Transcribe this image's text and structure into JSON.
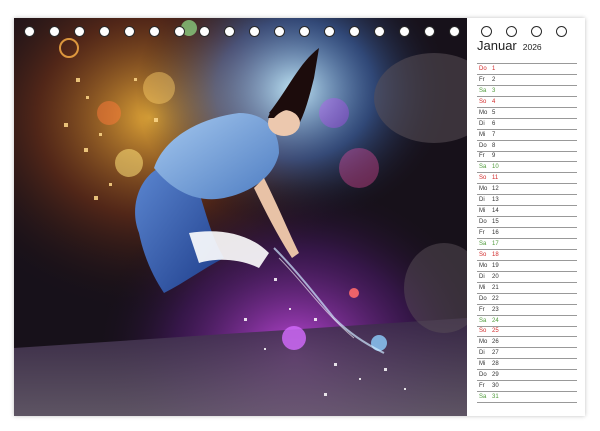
{
  "calendar": {
    "month": "Januar",
    "year": "2026",
    "days": [
      {
        "weekday": "Do",
        "day": "1",
        "type": "sun"
      },
      {
        "weekday": "Fr",
        "day": "2",
        "type": "weekday"
      },
      {
        "weekday": "Sa",
        "day": "3",
        "type": "sat"
      },
      {
        "weekday": "So",
        "day": "4",
        "type": "sun"
      },
      {
        "weekday": "Mo",
        "day": "5",
        "type": "weekday"
      },
      {
        "weekday": "Di",
        "day": "6",
        "type": "weekday"
      },
      {
        "weekday": "Mi",
        "day": "7",
        "type": "weekday"
      },
      {
        "weekday": "Do",
        "day": "8",
        "type": "weekday"
      },
      {
        "weekday": "Fr",
        "day": "9",
        "type": "weekday"
      },
      {
        "weekday": "Sa",
        "day": "10",
        "type": "sat"
      },
      {
        "weekday": "So",
        "day": "11",
        "type": "sun"
      },
      {
        "weekday": "Mo",
        "day": "12",
        "type": "weekday"
      },
      {
        "weekday": "Di",
        "day": "13",
        "type": "weekday"
      },
      {
        "weekday": "Mi",
        "day": "14",
        "type": "weekday"
      },
      {
        "weekday": "Do",
        "day": "15",
        "type": "weekday"
      },
      {
        "weekday": "Fr",
        "day": "16",
        "type": "weekday"
      },
      {
        "weekday": "Sa",
        "day": "17",
        "type": "sat"
      },
      {
        "weekday": "So",
        "day": "18",
        "type": "sun"
      },
      {
        "weekday": "Mo",
        "day": "19",
        "type": "weekday"
      },
      {
        "weekday": "Di",
        "day": "20",
        "type": "weekday"
      },
      {
        "weekday": "Mi",
        "day": "21",
        "type": "weekday"
      },
      {
        "weekday": "Do",
        "day": "22",
        "type": "weekday"
      },
      {
        "weekday": "Fr",
        "day": "23",
        "type": "weekday"
      },
      {
        "weekday": "Sa",
        "day": "24",
        "type": "sat"
      },
      {
        "weekday": "So",
        "day": "25",
        "type": "sun"
      },
      {
        "weekday": "Mo",
        "day": "26",
        "type": "weekday"
      },
      {
        "weekday": "Di",
        "day": "27",
        "type": "weekday"
      },
      {
        "weekday": "Mi",
        "day": "28",
        "type": "weekday"
      },
      {
        "weekday": "Do",
        "day": "29",
        "type": "weekday"
      },
      {
        "weekday": "Fr",
        "day": "30",
        "type": "weekday"
      },
      {
        "weekday": "Sa",
        "day": "31",
        "type": "sat"
      }
    ]
  },
  "colors": {
    "saturday": "#4f9a3a",
    "sunday_holiday": "#d12a2a",
    "text": "#333333",
    "rule": "#999999"
  }
}
